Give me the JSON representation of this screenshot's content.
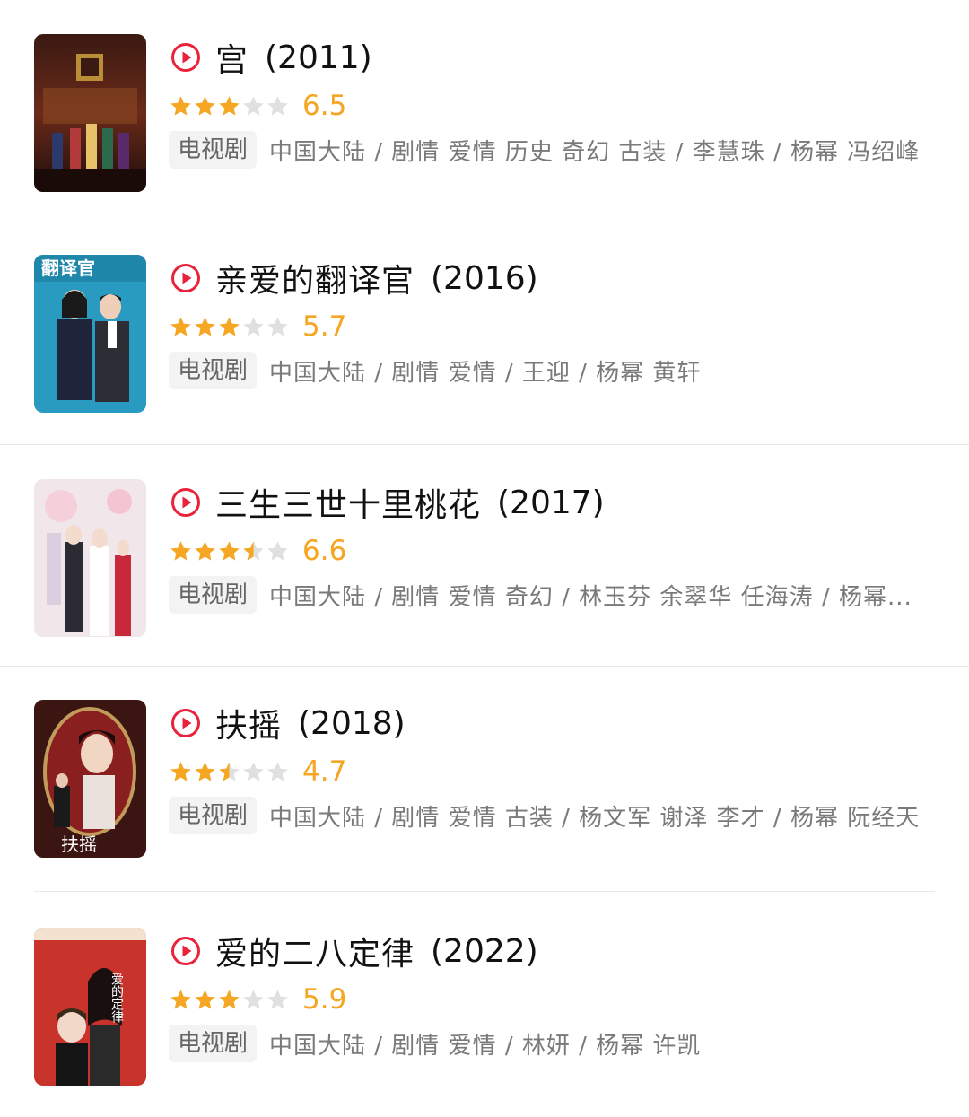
{
  "colors": {
    "accent_red": "#e8233b",
    "star_gold": "#f5a623",
    "star_gray": "#e0e0e0",
    "tag_bg": "#f3f3f3"
  },
  "items": [
    {
      "title": "宫",
      "year": "(2011)",
      "stars": 3,
      "rating": "6.5",
      "tag": "电视剧",
      "meta": "中国大陆 / 剧情 爱情 历史 奇幻 古装 / 李慧珠 / 杨幂 冯绍峰",
      "poster_icon": "poster-gong",
      "poster_text": ""
    },
    {
      "title": "亲爱的翻译官",
      "year": "(2016)",
      "stars": 3,
      "rating": "5.7",
      "tag": "电视剧",
      "meta": "中国大陆 / 剧情 爱情 / 王迎 / 杨幂 黄轩",
      "poster_icon": "poster-translator",
      "poster_text": "翻译官"
    },
    {
      "title": "三生三世十里桃花",
      "year": "(2017)",
      "stars": 3.5,
      "rating": "6.6",
      "tag": "电视剧",
      "meta": "中国大陆 / 剧情 爱情 奇幻 / 林玉芬 余翠华 任海涛 / 杨幂...",
      "poster_icon": "poster-peach-blossom",
      "poster_text": ""
    },
    {
      "title": "扶摇",
      "year": "(2018)",
      "stars": 2.5,
      "rating": "4.7",
      "tag": "电视剧",
      "meta": "中国大陆 / 剧情 爱情 古装 / 杨文军 谢泽 李才 / 杨幂 阮经天",
      "poster_icon": "poster-fuyao",
      "poster_text": "扶摇"
    },
    {
      "title": "爱的二八定律",
      "year": "(2022)",
      "stars": 3,
      "rating": "5.9",
      "tag": "电视剧",
      "meta": "中国大陆 / 剧情 爱情 / 林妍 / 杨幂 许凯",
      "poster_icon": "poster-love-law",
      "poster_text": "爱的定律"
    }
  ]
}
